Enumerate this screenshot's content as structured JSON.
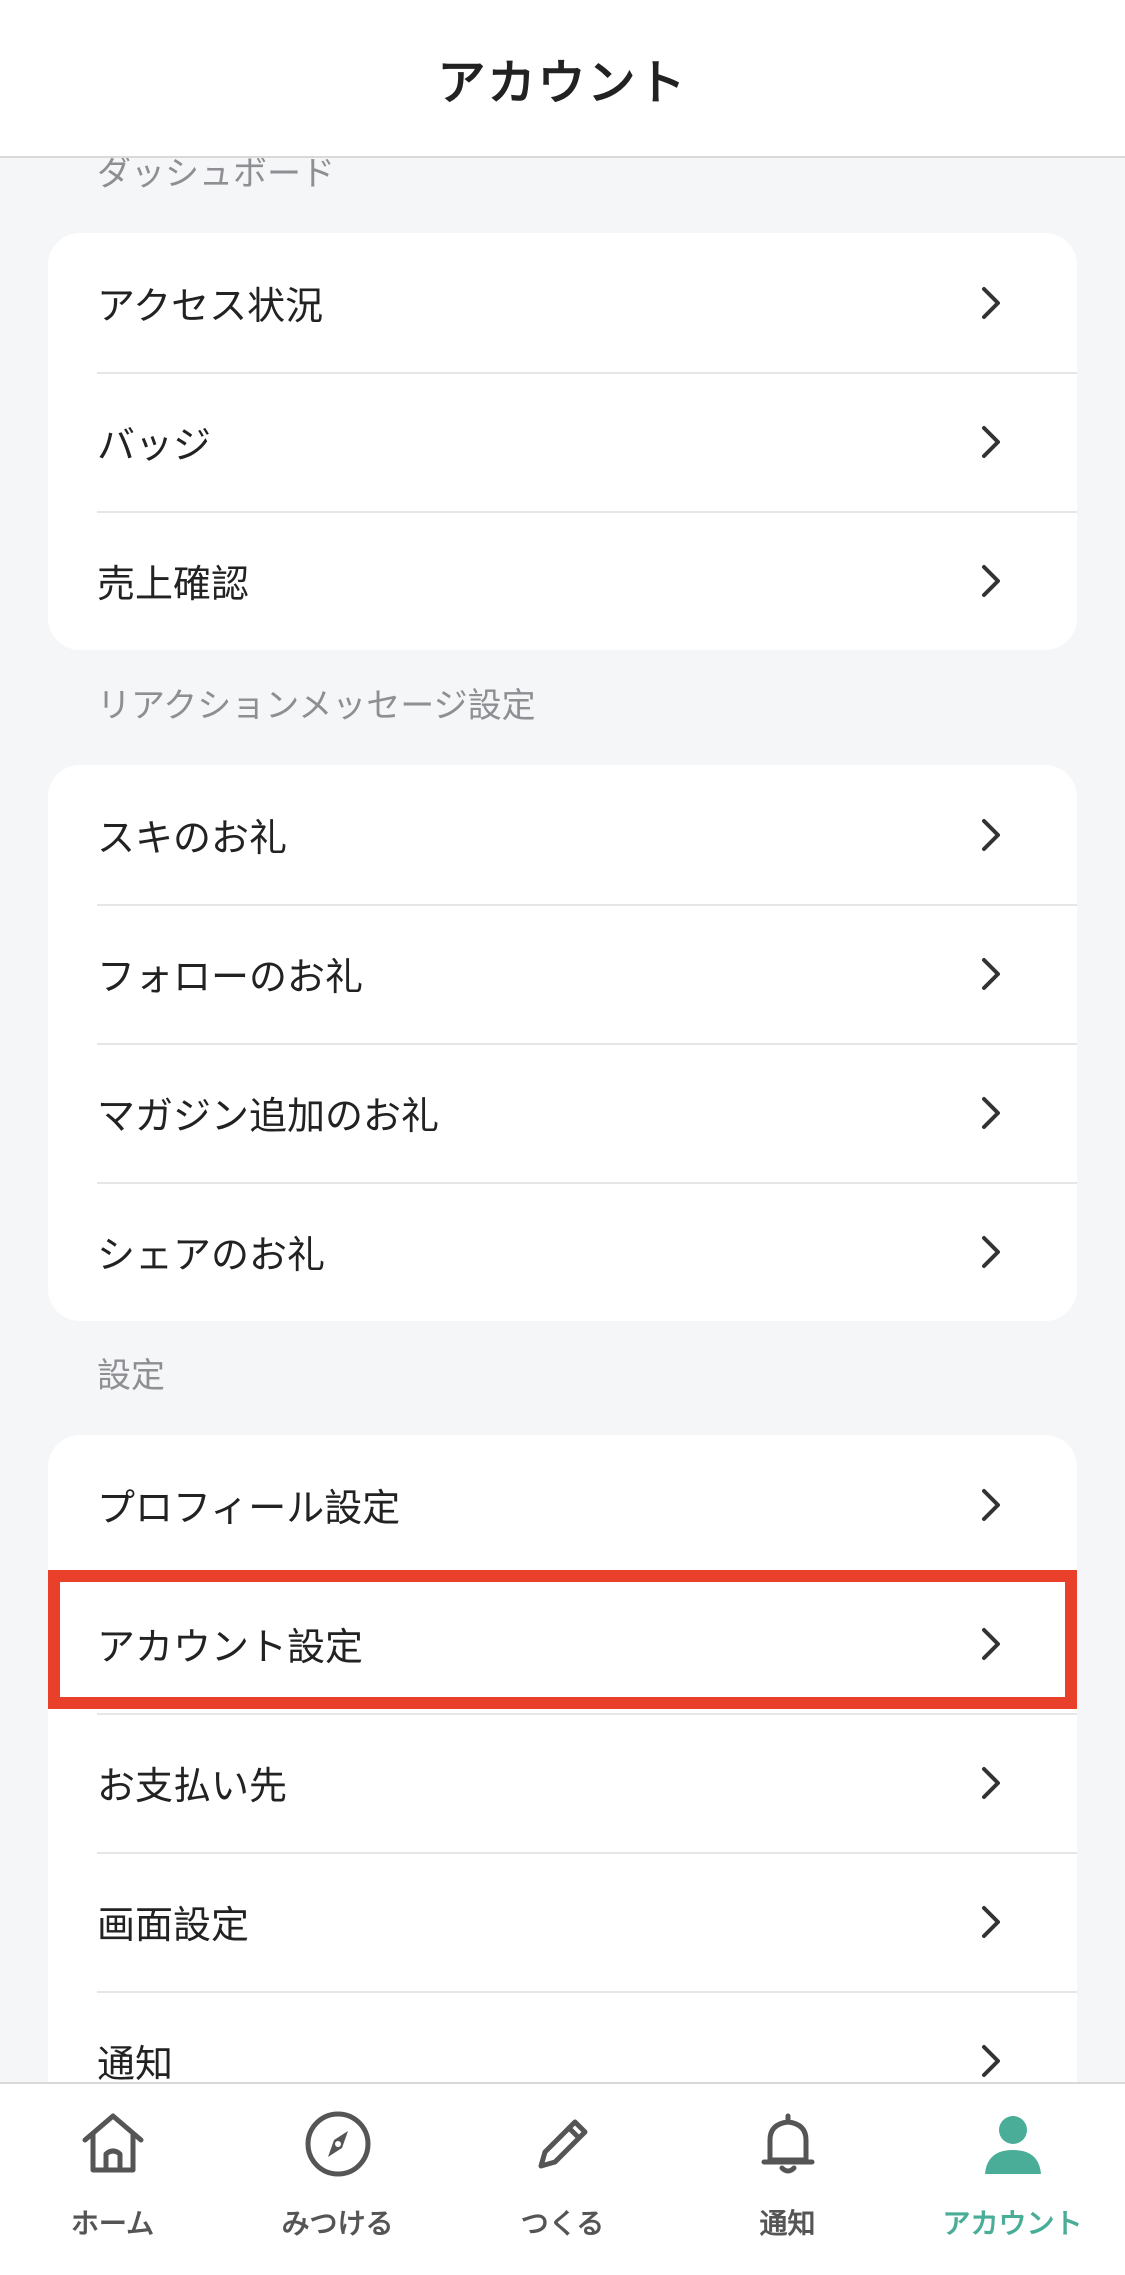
{
  "header": {
    "title": "アカウント"
  },
  "sections": [
    {
      "label": "ダッシュボード",
      "items": [
        {
          "label": "アクセス状況"
        },
        {
          "label": "バッジ"
        },
        {
          "label": "売上確認"
        }
      ]
    },
    {
      "label": "リアクションメッセージ設定",
      "items": [
        {
          "label": "スキのお礼"
        },
        {
          "label": "フォローのお礼"
        },
        {
          "label": "マガジン追加のお礼"
        },
        {
          "label": "シェアのお礼"
        }
      ]
    },
    {
      "label": "設定",
      "items": [
        {
          "label": "プロフィール設定"
        },
        {
          "label": "アカウント設定",
          "highlighted": true
        },
        {
          "label": "お支払い先"
        },
        {
          "label": "画面設定"
        },
        {
          "label": "通知"
        }
      ]
    }
  ],
  "tabbar": {
    "tabs": [
      {
        "label": "ホーム",
        "icon": "home-icon"
      },
      {
        "label": "みつける",
        "icon": "compass-icon"
      },
      {
        "label": "つくる",
        "icon": "pencil-icon"
      },
      {
        "label": "通知",
        "icon": "bell-icon"
      },
      {
        "label": "アカウント",
        "icon": "user-icon",
        "active": true
      }
    ]
  },
  "colors": {
    "accent": "#4aad97",
    "highlight_border": "#e8402b",
    "background": "#f5f6f8",
    "section_label": "#8e8e93"
  }
}
